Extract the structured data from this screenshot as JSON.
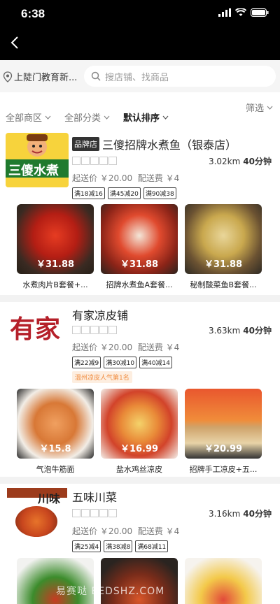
{
  "status": {
    "time": "6:38"
  },
  "location": {
    "text": "上陡门教育新..."
  },
  "search": {
    "placeholder": "搜店铺、找商品"
  },
  "filters": {
    "area": "全部商区",
    "category": "全部分类",
    "sort": "默认排序",
    "screen": "筛选"
  },
  "shops": [
    {
      "tag": "品牌店",
      "name": "三傻招牌水煮鱼（银泰店）",
      "distance": "3.02km",
      "time": "40分钟",
      "min_order": "起送价 ￥20.00",
      "delivery_fee": "配送费 ￥4",
      "discounts": [
        "满18减16",
        "满45减20",
        "满90减38"
      ],
      "logo_text": "三傻水煮",
      "dishes": [
        {
          "price": "￥31.88",
          "name": "水煮肉片B套餐+..."
        },
        {
          "price": "￥31.88",
          "name": "招牌水煮鱼A套餐..."
        },
        {
          "price": "￥31.88",
          "name": "秘制酸菜鱼B套餐..."
        }
      ]
    },
    {
      "name": "有家凉皮铺",
      "distance": "3.63km",
      "time": "40分钟",
      "min_order": "起送价 ￥20.00",
      "delivery_fee": "配送费 ￥4",
      "discounts": [
        "满22减9",
        "满30减10",
        "满40减14"
      ],
      "rank": "温州凉皮人气第1名",
      "logo_text": "有家",
      "dishes": [
        {
          "price": "￥15.8",
          "name": "气泡牛筋面"
        },
        {
          "price": "￥16.99",
          "name": "盐水鸡丝凉皮"
        },
        {
          "price": "￥20.99",
          "name": "招牌手工凉皮+五..."
        }
      ]
    },
    {
      "name": "五味川菜",
      "distance": "3.16km",
      "time": "40分钟",
      "min_order": "起送价 ￥20.00",
      "delivery_fee": "配送费 ￥4",
      "discounts": [
        "满25减4",
        "满38减8",
        "满68减11"
      ],
      "logo_text": "川味"
    }
  ],
  "watermark": "易赛哒 EEDSHZ.COM"
}
